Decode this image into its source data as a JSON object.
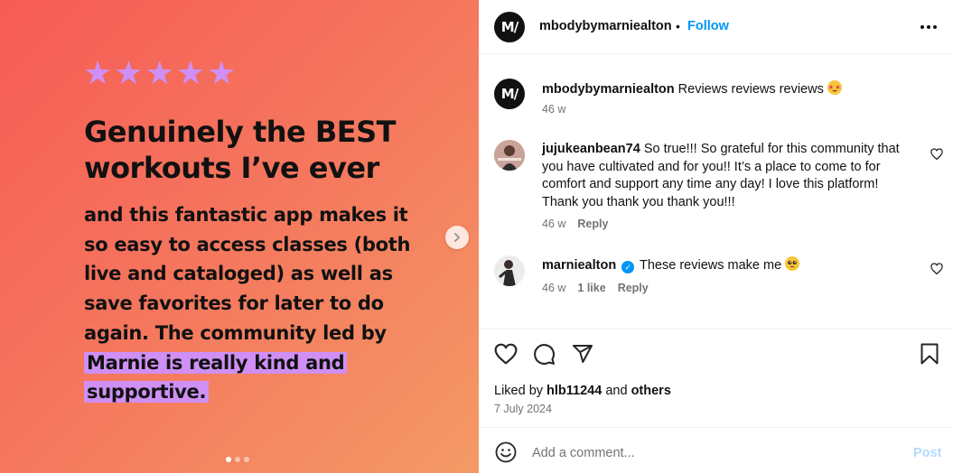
{
  "media": {
    "stars": [
      "★",
      "★",
      "★",
      "★",
      "★"
    ],
    "headline_lines": [
      "Genuinely the BEST",
      "workouts I’ve ever"
    ],
    "body_lines": [
      "and this fantastic app makes it",
      "so easy to access classes (both",
      "live and cataloged) as well as",
      "save favorites for later to do",
      "again. The community led by"
    ],
    "highlight_lines": [
      "Marnie is really kind and",
      "supportive."
    ],
    "colors": {
      "star": "#cf8ff5",
      "highlight": "#cf8ff5",
      "bg_start": "#f75c55",
      "bg_end": "#f49a66"
    },
    "carousel": {
      "count": 3,
      "active": 1
    }
  },
  "header": {
    "avatar_text": "M/",
    "username": "mbodybymarniealton",
    "separator": "•",
    "follow_label": "Follow",
    "more_icon": "more-horizontal-icon"
  },
  "caption": {
    "avatar_text": "M/",
    "username": "mbodybymarniealton",
    "text": "Reviews reviews reviews",
    "emoji": "star-struck-emoji",
    "time": "46 w"
  },
  "comments": [
    {
      "username": "jujukeanbean74",
      "lines": [
        "So true!!! So grateful for this community that",
        "you have cultivated and for you!! It’s a place to come to for",
        "comfort and support any time any day! I love this platform!",
        "Thank you thank you thank you!!!"
      ],
      "time": "46 w",
      "reply_label": "Reply"
    },
    {
      "username": "marniealton",
      "verified": true,
      "text": "These reviews make me",
      "emoji": "pleading-face-emoji",
      "time": "46 w",
      "likes_label": "1 like",
      "reply_label": "Reply"
    }
  ],
  "actions": {
    "liked_by_prefix": "Liked by",
    "liked_by_user": "hlb11244",
    "liked_by_and": "and",
    "liked_by_others": "others",
    "date": "7 July 2024"
  },
  "add_comment": {
    "placeholder": "Add a comment...",
    "post_label": "Post"
  }
}
